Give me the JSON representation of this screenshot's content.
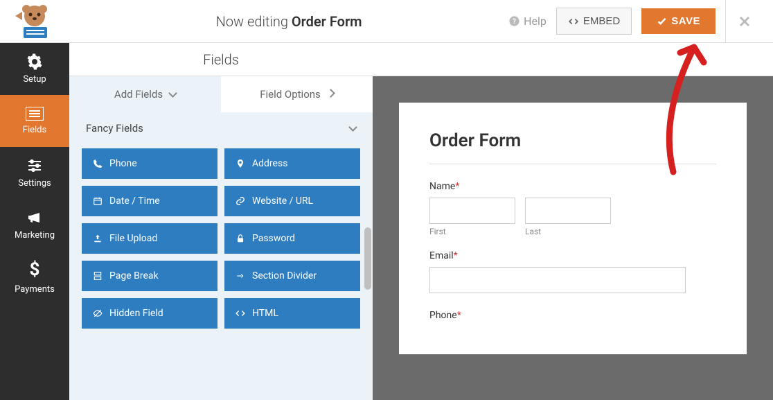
{
  "header": {
    "editing_prefix": "Now editing ",
    "form_name": "Order Form",
    "help": "Help",
    "embed": "EMBED",
    "save": "SAVE"
  },
  "sidenav": {
    "setup": "Setup",
    "fields": "Fields",
    "settings": "Settings",
    "marketing": "Marketing",
    "payments": "Payments"
  },
  "panel": {
    "title": "Fields",
    "tab_add": "Add Fields",
    "tab_options": "Field Options",
    "section": "Fancy Fields",
    "items": {
      "phone": "Phone",
      "address": "Address",
      "datetime": "Date / Time",
      "website": "Website / URL",
      "upload": "File Upload",
      "password": "Password",
      "pagebreak": "Page Break",
      "divider": "Section Divider",
      "hidden": "Hidden Field",
      "html": "HTML"
    }
  },
  "form": {
    "title": "Order Form",
    "name_label": "Name",
    "first": "First",
    "last": "Last",
    "email_label": "Email",
    "phone_label": "Phone"
  }
}
